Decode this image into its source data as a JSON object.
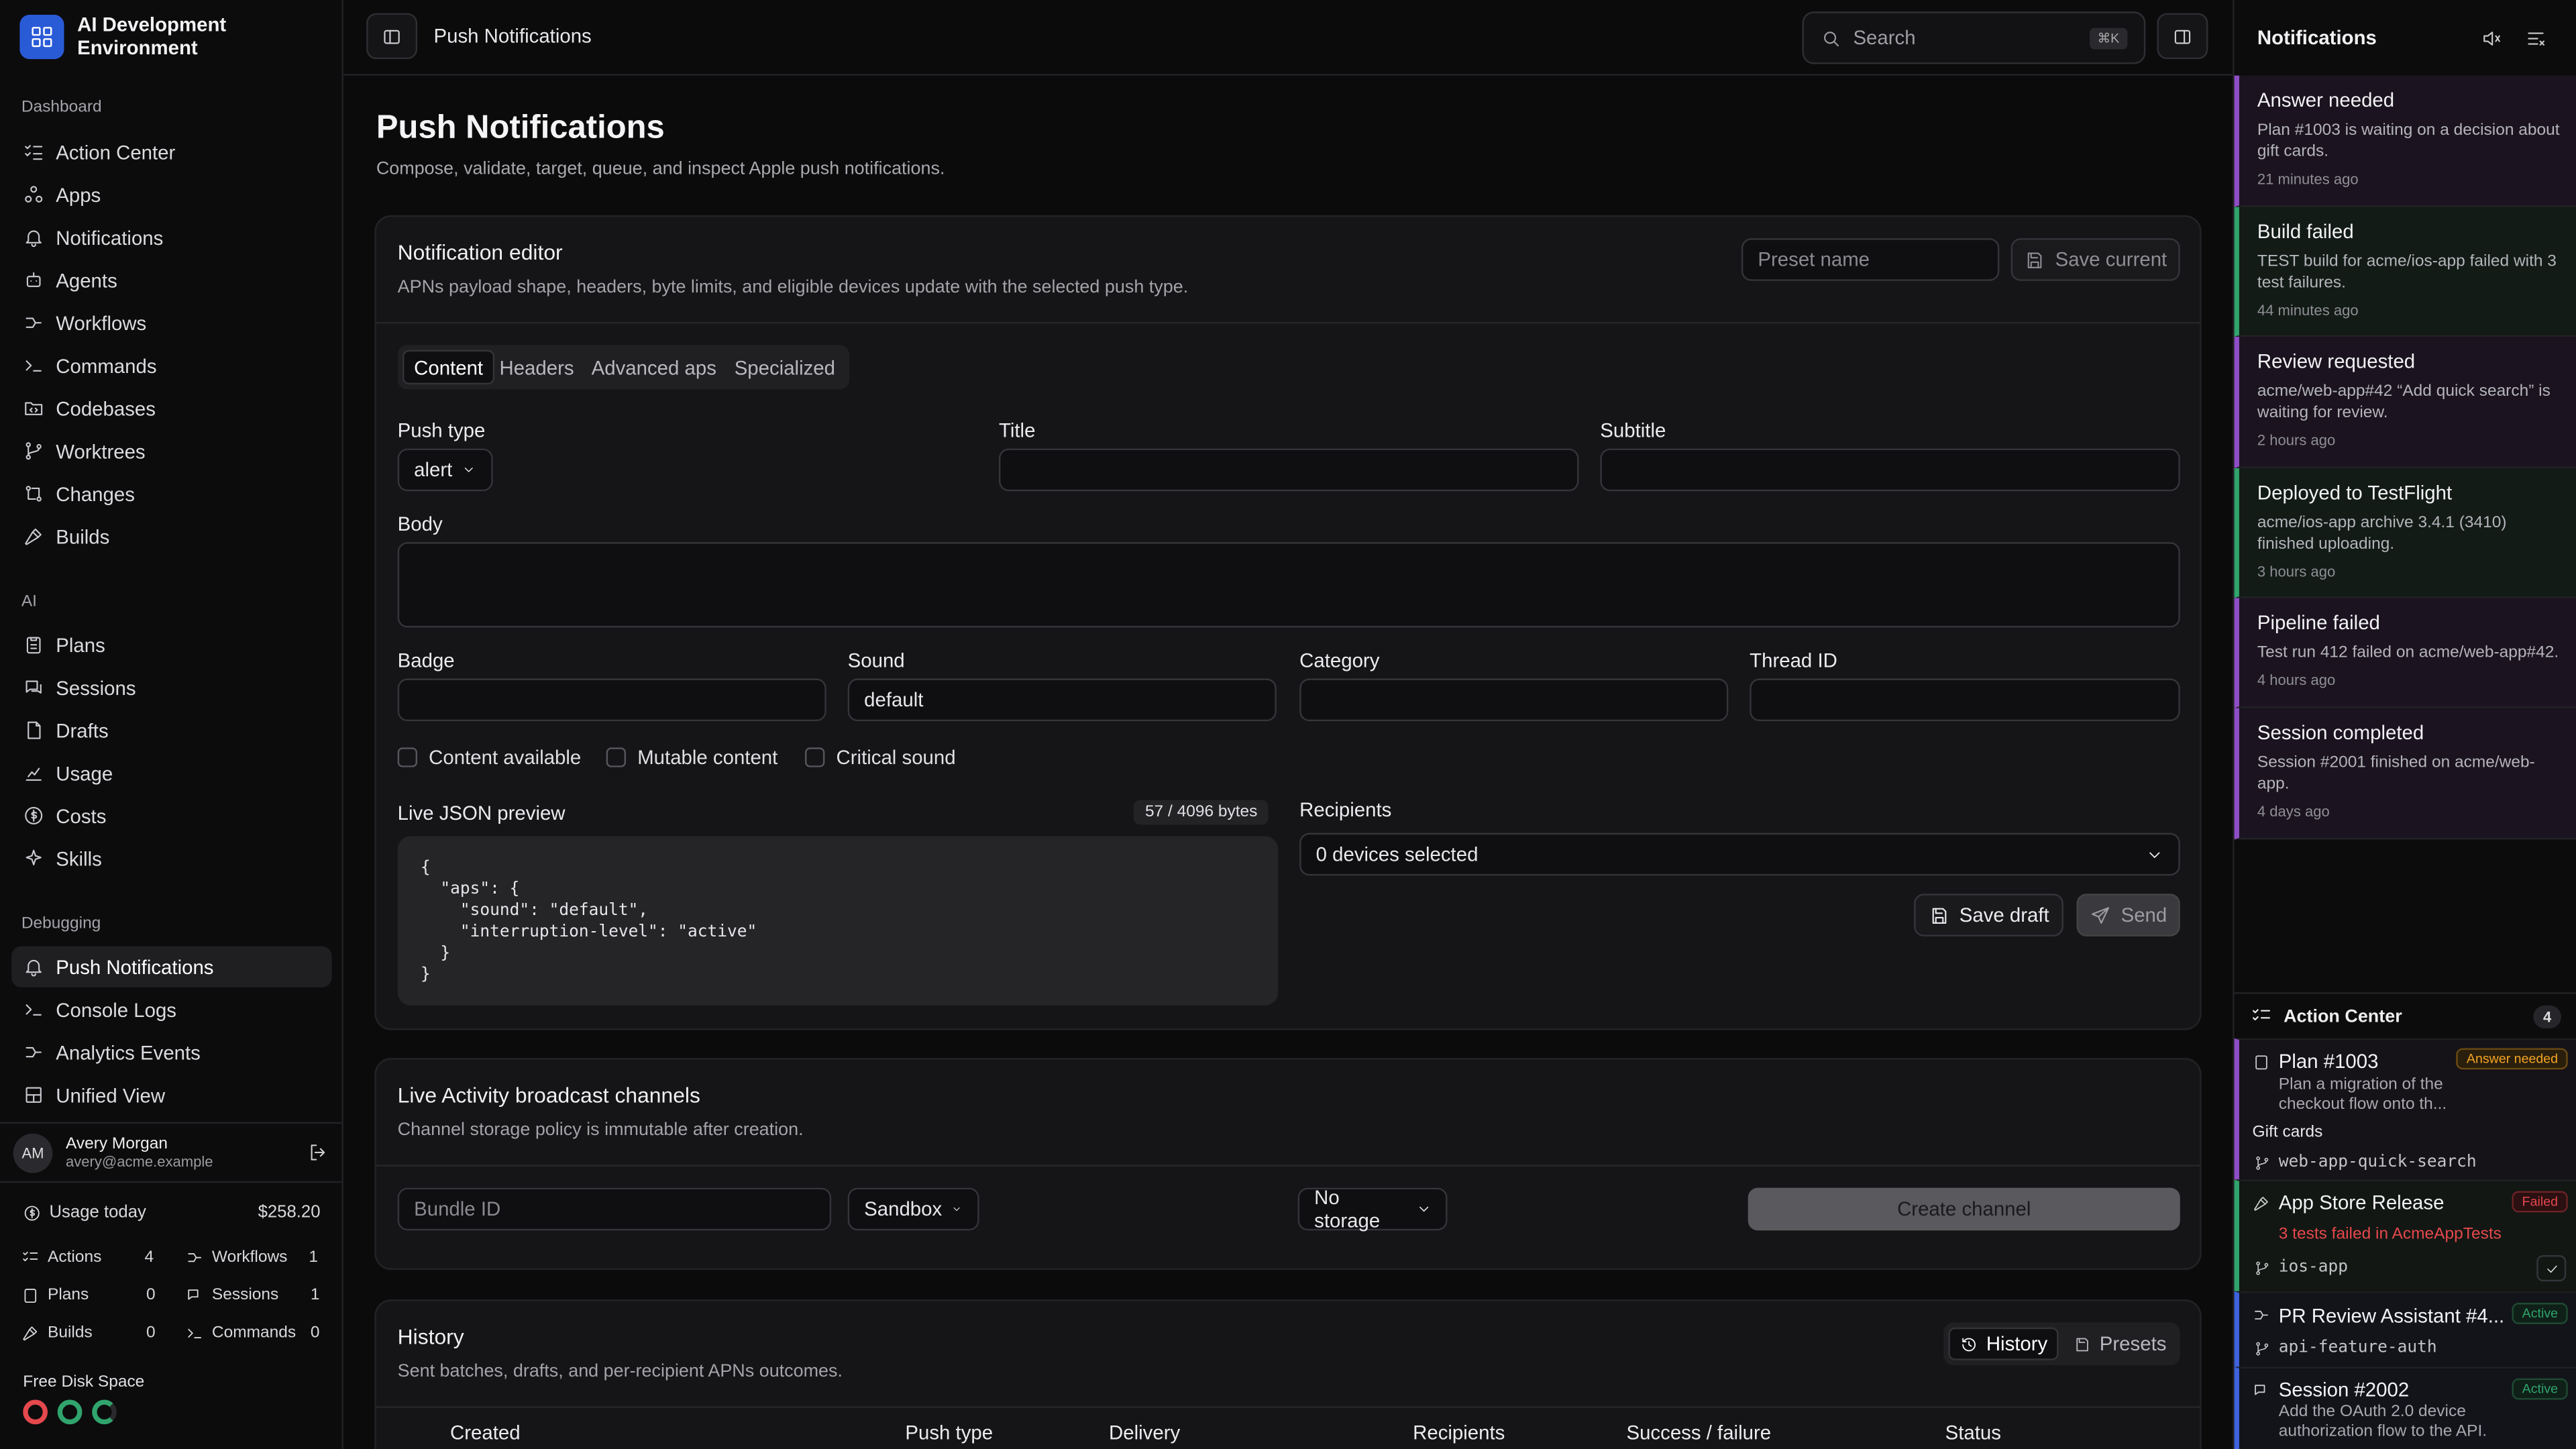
{
  "app": {
    "title": "AI Development Environment"
  },
  "sidebar": {
    "sections": [
      {
        "label": "Dashboard"
      },
      {
        "label": "AI"
      },
      {
        "label": "Debugging"
      }
    ],
    "dashboard_items": [
      {
        "label": "Action Center",
        "icon": "list-checks-icon"
      },
      {
        "label": "Apps",
        "icon": "apps-icon"
      },
      {
        "label": "Notifications",
        "icon": "bell-icon"
      },
      {
        "label": "Agents",
        "icon": "bot-icon"
      },
      {
        "label": "Workflows",
        "icon": "workflow-icon"
      },
      {
        "label": "Commands",
        "icon": "terminal-icon"
      },
      {
        "label": "Codebases",
        "icon": "folder-code-icon"
      },
      {
        "label": "Worktrees",
        "icon": "git-branch-icon"
      },
      {
        "label": "Changes",
        "icon": "git-compare-icon"
      },
      {
        "label": "Builds",
        "icon": "hammer-icon"
      }
    ],
    "ai_items": [
      {
        "label": "Plans",
        "icon": "clipboard-icon"
      },
      {
        "label": "Sessions",
        "icon": "chat-icon"
      },
      {
        "label": "Drafts",
        "icon": "file-icon"
      },
      {
        "label": "Usage",
        "icon": "chart-icon"
      },
      {
        "label": "Costs",
        "icon": "dollar-icon"
      },
      {
        "label": "Skills",
        "icon": "sparkles-icon"
      }
    ],
    "debug_items": [
      {
        "label": "Push Notifications",
        "icon": "bell-ring-icon",
        "active": true
      },
      {
        "label": "Console Logs",
        "icon": "terminal-icon"
      },
      {
        "label": "Analytics Events",
        "icon": "activity-icon"
      },
      {
        "label": "Unified View",
        "icon": "layout-icon"
      }
    ],
    "user": {
      "initials": "AM",
      "name": "Avery Morgan",
      "email": "avery@acme.example"
    },
    "usage": {
      "label": "Usage today",
      "amount": "$258.20",
      "stats": [
        {
          "label": "Actions",
          "value": "4"
        },
        {
          "label": "Workflows",
          "value": "1"
        },
        {
          "label": "Plans",
          "value": "0"
        },
        {
          "label": "Sessions",
          "value": "1"
        },
        {
          "label": "Builds",
          "value": "0"
        },
        {
          "label": "Commands",
          "value": "0"
        }
      ]
    },
    "disk": {
      "label": "Free Disk Space",
      "colors": [
        "#e5484d",
        "#30a46c",
        "#30a46c"
      ]
    }
  },
  "topbar": {
    "breadcrumb": "Push Notifications",
    "search_placeholder": "Search",
    "search_shortcut": "⌘K"
  },
  "page": {
    "title": "Push Notifications",
    "description": "Compose, validate, target, queue, and inspect Apple push notifications."
  },
  "editor": {
    "title": "Notification editor",
    "description": "APNs payload shape, headers, byte limits, and eligible devices update with the selected push type.",
    "preset_placeholder": "Preset name",
    "save_current": "Save current",
    "tabs": [
      "Content",
      "Headers",
      "Advanced aps",
      "Specialized"
    ],
    "active_tab": "Content",
    "fields": {
      "push_type_label": "Push type",
      "push_type_value": "alert",
      "title_label": "Title",
      "title_value": "",
      "subtitle_label": "Subtitle",
      "subtitle_value": "",
      "body_label": "Body",
      "body_value": "",
      "badge_label": "Badge",
      "badge_value": "",
      "sound_label": "Sound",
      "sound_value": "default",
      "category_label": "Category",
      "category_value": "",
      "thread_label": "Thread ID",
      "thread_value": ""
    },
    "checkboxes": [
      {
        "label": "Content available",
        "checked": false
      },
      {
        "label": "Mutable content",
        "checked": false
      },
      {
        "label": "Critical sound",
        "checked": false
      }
    ],
    "json_label": "Live JSON preview",
    "json_bytes": "57 / 4096 bytes",
    "json_preview": "{\n  \"aps\": {\n    \"sound\": \"default\",\n    \"interruption-level\": \"active\"\n  }\n}",
    "recipients_label": "Recipients",
    "recipients_value": "0 devices selected",
    "save_draft": "Save draft",
    "send": "Send"
  },
  "broadcast": {
    "title": "Live Activity broadcast channels",
    "description": "Channel storage policy is immutable after creation.",
    "bundle_placeholder": "Bundle ID",
    "environment": "Sandbox",
    "storage": "No storage",
    "create": "Create channel"
  },
  "history": {
    "title": "History",
    "description": "Sent batches, drafts, and per-recipient APNs outcomes.",
    "toggle": [
      "History",
      "Presets"
    ],
    "columns": [
      "Created",
      "Push type",
      "Delivery",
      "Recipients",
      "Success / failure",
      "Status"
    ]
  },
  "notifications": {
    "title": "Notifications",
    "items": [
      {
        "title": "Answer needed",
        "body": "Plan #1003 is waiting on a decision about gift cards.",
        "time": "21 minutes ago",
        "color": "#8e4ec6",
        "bg": "#1b1420"
      },
      {
        "title": "Build failed",
        "body": "TEST build for acme/ios-app failed with 3 test failures.",
        "time": "44 minutes ago",
        "color": "#30a46c",
        "bg": "#121b16"
      },
      {
        "title": "Review requested",
        "body": "acme/web-app#42 “Add quick search” is waiting for review.",
        "time": "2 hours ago",
        "color": "#8e4ec6",
        "bg": "#1b1420"
      },
      {
        "title": "Deployed to TestFlight",
        "body": "acme/ios-app archive 3.4.1 (3410) finished uploading.",
        "time": "3 hours ago",
        "color": "#30a46c",
        "bg": "#121b16"
      },
      {
        "title": "Pipeline failed",
        "body": "Test run 412 failed on acme/web-app#42.",
        "time": "4 hours ago",
        "color": "#8e4ec6",
        "bg": "#1b1420"
      },
      {
        "title": "Session completed",
        "body": "Session #2001 finished on acme/web-app.",
        "time": "4 days ago",
        "color": "#8e4ec6",
        "bg": "#1b1420"
      }
    ]
  },
  "action_center": {
    "title": "Action Center",
    "count": "4",
    "items": [
      {
        "name": "Plan #1003",
        "badge": "Answer needed",
        "sub": "Plan a migration of the checkout flow onto th...",
        "extra": "Gift cards",
        "branch": "web-app-quick-search",
        "color": "#8e4ec6",
        "badge_color": "#f5a524"
      },
      {
        "name": "App Store Release",
        "badge": "Failed",
        "sub": "3 tests failed in AcmeAppTests",
        "branch": "ios-app",
        "color": "#30a46c",
        "badge_color": "#e5484d"
      },
      {
        "name": "PR Review Assistant #4...",
        "badge": "Active",
        "branch": "api-feature-auth",
        "color": "#3e63dd",
        "badge_color": "#30a46c"
      },
      {
        "name": "Session #2002",
        "badge": "Active",
        "sub": "Add the OAuth 2.0 device authorization flow to the API.",
        "color": "#3e63dd",
        "badge_color": "#30a46c"
      }
    ]
  },
  "colors": {
    "accent": "#2a5bd7",
    "background": "#0b0b0c",
    "card": "#151517"
  }
}
